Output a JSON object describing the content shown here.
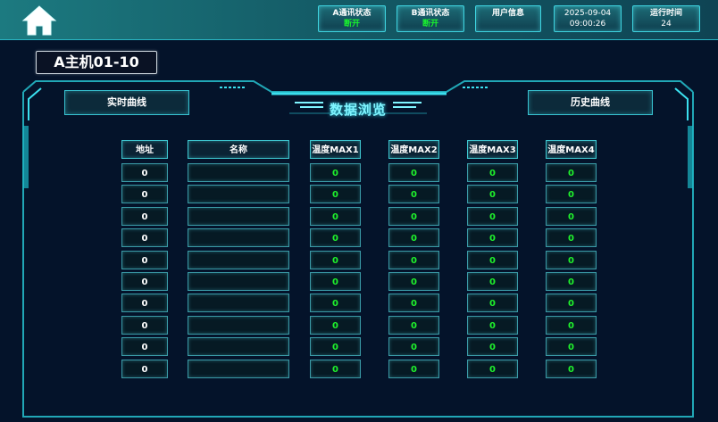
{
  "header": {
    "status_a": {
      "label": "A通讯状态",
      "value": "断开"
    },
    "status_b": {
      "label": "B通讯状态",
      "value": "断开"
    },
    "user_info": {
      "label": "用户信息"
    },
    "datetime": {
      "date": "2025-09-04",
      "time": "09:00:26"
    },
    "runtime": {
      "label": "运行时间",
      "value": "24"
    }
  },
  "page_title": "A主机01-10",
  "buttons": {
    "realtime": "实时曲线",
    "history": "历史曲线"
  },
  "section_title": "数据浏览",
  "table": {
    "headers": {
      "address": "地址",
      "name": "名称",
      "t1": "温度MAX1",
      "t2": "温度MAX2",
      "t3": "温度MAX3",
      "t4": "温度MAX4"
    },
    "rows": [
      {
        "address": "0",
        "name": "",
        "t1": "0",
        "t2": "0",
        "t3": "0",
        "t4": "0"
      },
      {
        "address": "0",
        "name": "",
        "t1": "0",
        "t2": "0",
        "t3": "0",
        "t4": "0"
      },
      {
        "address": "0",
        "name": "",
        "t1": "0",
        "t2": "0",
        "t3": "0",
        "t4": "0"
      },
      {
        "address": "0",
        "name": "",
        "t1": "0",
        "t2": "0",
        "t3": "0",
        "t4": "0"
      },
      {
        "address": "0",
        "name": "",
        "t1": "0",
        "t2": "0",
        "t3": "0",
        "t4": "0"
      },
      {
        "address": "0",
        "name": "",
        "t1": "0",
        "t2": "0",
        "t3": "0",
        "t4": "0"
      },
      {
        "address": "0",
        "name": "",
        "t1": "0",
        "t2": "0",
        "t3": "0",
        "t4": "0"
      },
      {
        "address": "0",
        "name": "",
        "t1": "0",
        "t2": "0",
        "t3": "0",
        "t4": "0"
      },
      {
        "address": "0",
        "name": "",
        "t1": "0",
        "t2": "0",
        "t3": "0",
        "t4": "0"
      },
      {
        "address": "0",
        "name": "",
        "t1": "0",
        "t2": "0",
        "t3": "0",
        "t4": "0"
      }
    ]
  },
  "colors": {
    "accent": "#3ec6cf",
    "ok_text": "#1ff22c",
    "background": "#04132a"
  }
}
